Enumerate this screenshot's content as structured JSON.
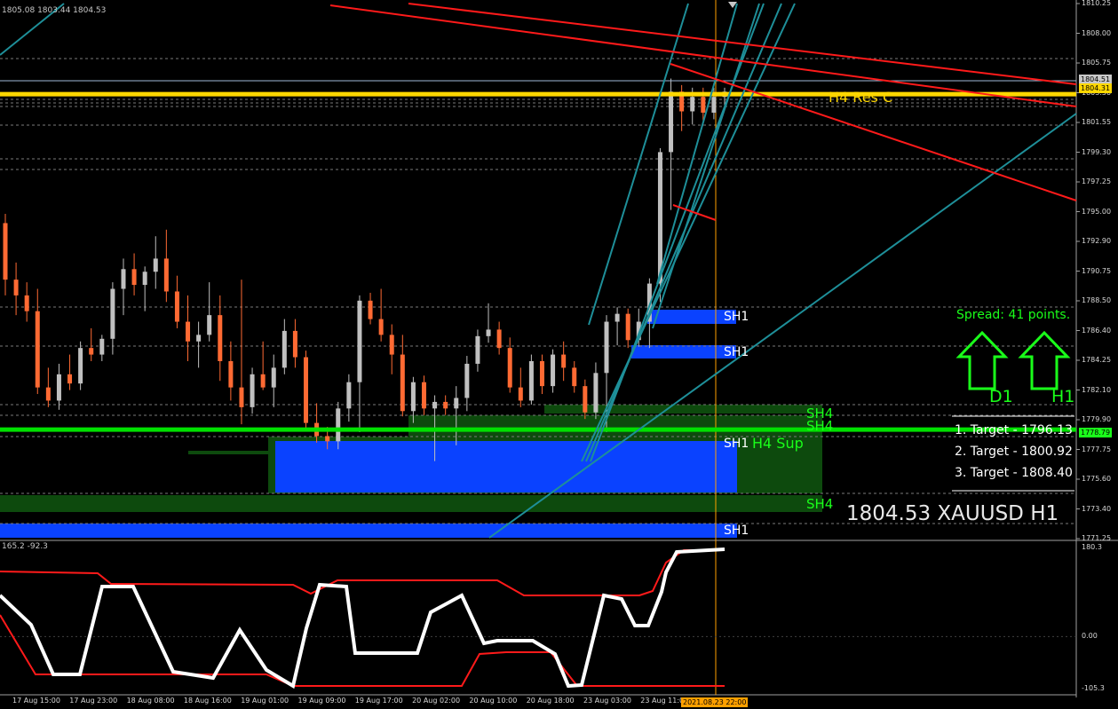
{
  "window": {
    "ohlc_header": "1805.08 1803.44 1804.53"
  },
  "chart_data": {
    "type": "candlestick",
    "symbol": "XAUUSD",
    "timeframe": "H1",
    "last_price": "1804.53",
    "title": "1804.53 XAUUSD H1",
    "ylim": [
      1770.5,
      1811.2
    ],
    "price_ticks": [
      "1810.25",
      "1808.00",
      "1805.75",
      "1803.50",
      "1801.55",
      "1799.30",
      "1797.25",
      "1795.00",
      "1792.90",
      "1790.75",
      "1788.50",
      "1786.40",
      "1784.25",
      "1782.10",
      "1779.90",
      "1777.75",
      "1775.60",
      "1773.40",
      "1771.25"
    ],
    "time_ticks": [
      "17 Aug 15:00",
      "17 Aug 23:00",
      "18 Aug 08:00",
      "18 Aug 16:00",
      "19 Aug 01:00",
      "19 Aug 09:00",
      "19 Aug 17:00",
      "20 Aug 02:00",
      "20 Aug 10:00",
      "20 Aug 18:00",
      "23 Aug 03:00",
      "23 Aug 11:00"
    ],
    "current_time_tag": "2021.08.23 22:00",
    "price_tags": {
      "bid": "1804.31",
      "ask": "1804.51",
      "support": "1778.79"
    },
    "levels": {
      "resistance": {
        "label": "H4 Res C",
        "price": 1804.31,
        "color": "#ffd700"
      },
      "support": {
        "label": "H4 Sup",
        "price": 1778.79,
        "color": "#00e000"
      }
    },
    "zone_labels": {
      "sh1": "SH1",
      "sh4": "SH4"
    },
    "candles": [
      [
        1794.5,
        1795.2,
        1789.0,
        1790.2
      ],
      [
        1790.2,
        1791.5,
        1787.5,
        1789.0
      ],
      [
        1789.0,
        1790.0,
        1787.0,
        1787.8
      ],
      [
        1787.8,
        1789.5,
        1781.5,
        1782.0
      ],
      [
        1782.0,
        1783.5,
        1780.5,
        1781.0
      ],
      [
        1781.0,
        1783.8,
        1780.3,
        1783.0
      ],
      [
        1783.0,
        1784.5,
        1781.8,
        1782.3
      ],
      [
        1782.3,
        1785.5,
        1781.8,
        1785.0
      ],
      [
        1785.0,
        1786.5,
        1784.0,
        1784.5
      ],
      [
        1784.5,
        1786.0,
        1784.0,
        1785.7
      ],
      [
        1785.7,
        1790.0,
        1784.5,
        1789.5
      ],
      [
        1789.5,
        1791.8,
        1787.5,
        1791.0
      ],
      [
        1791.0,
        1792.2,
        1789.0,
        1789.8
      ],
      [
        1789.8,
        1791.2,
        1787.8,
        1790.8
      ],
      [
        1790.8,
        1793.5,
        1789.5,
        1791.8
      ],
      [
        1791.8,
        1794.0,
        1788.5,
        1789.3
      ],
      [
        1789.3,
        1790.5,
        1786.5,
        1787.0
      ],
      [
        1787.0,
        1789.0,
        1784.0,
        1785.5
      ],
      [
        1785.5,
        1787.0,
        1783.5,
        1786.0
      ],
      [
        1786.0,
        1790.0,
        1785.5,
        1787.5
      ],
      [
        1787.5,
        1789.0,
        1782.5,
        1784.0
      ],
      [
        1784.0,
        1785.5,
        1781.0,
        1782.0
      ],
      [
        1782.0,
        1790.2,
        1779.2,
        1780.5
      ],
      [
        1780.5,
        1783.5,
        1780.0,
        1783.0
      ],
      [
        1783.0,
        1785.5,
        1781.8,
        1782.0
      ],
      [
        1782.0,
        1784.5,
        1780.5,
        1783.5
      ],
      [
        1783.5,
        1787.2,
        1783.0,
        1786.3
      ],
      [
        1786.3,
        1787.2,
        1783.5,
        1784.3
      ],
      [
        1784.3,
        1784.8,
        1778.8,
        1779.3
      ],
      [
        1779.3,
        1780.8,
        1777.8,
        1778.3
      ],
      [
        1778.3,
        1779.0,
        1777.3,
        1777.9
      ],
      [
        1777.9,
        1780.9,
        1777.3,
        1780.4
      ],
      [
        1780.4,
        1783.0,
        1779.4,
        1782.4
      ],
      [
        1782.4,
        1789.0,
        1778.6,
        1788.6
      ],
      [
        1788.6,
        1789.2,
        1786.8,
        1787.2
      ],
      [
        1787.2,
        1789.5,
        1785.5,
        1786.0
      ],
      [
        1786.0,
        1786.8,
        1783.0,
        1784.5
      ],
      [
        1784.5,
        1786.0,
        1779.8,
        1780.2
      ],
      [
        1780.2,
        1782.8,
        1779.3,
        1782.4
      ],
      [
        1782.4,
        1782.9,
        1779.9,
        1780.4
      ],
      [
        1780.4,
        1781.4,
        1776.4,
        1780.9
      ],
      [
        1780.9,
        1781.4,
        1779.9,
        1780.4
      ],
      [
        1780.4,
        1782.1,
        1777.6,
        1781.2
      ],
      [
        1781.2,
        1784.4,
        1780.2,
        1783.8
      ],
      [
        1783.8,
        1786.4,
        1783.2,
        1785.9
      ],
      [
        1785.9,
        1788.4,
        1785.4,
        1786.4
      ],
      [
        1786.4,
        1787.0,
        1784.5,
        1785.0
      ],
      [
        1785.0,
        1785.8,
        1781.6,
        1782.0
      ],
      [
        1782.0,
        1783.5,
        1780.5,
        1781.0
      ],
      [
        1781.0,
        1784.5,
        1780.7,
        1784.0
      ],
      [
        1784.0,
        1784.5,
        1781.5,
        1782.1
      ],
      [
        1782.1,
        1784.9,
        1781.6,
        1784.5
      ],
      [
        1784.5,
        1785.5,
        1782.5,
        1783.5
      ],
      [
        1783.5,
        1784.0,
        1781.6,
        1782.1
      ],
      [
        1782.1,
        1782.6,
        1779.6,
        1780.1
      ],
      [
        1780.1,
        1783.9,
        1779.6,
        1783.1
      ],
      [
        1783.1,
        1787.5,
        1778.6,
        1787.0
      ],
      [
        1787.0,
        1788.1,
        1785.2,
        1787.6
      ],
      [
        1787.6,
        1788.0,
        1785.0,
        1785.6
      ],
      [
        1785.6,
        1788.0,
        1785.1,
        1787.0
      ],
      [
        1787.0,
        1790.3,
        1785.0,
        1789.9
      ],
      [
        1789.9,
        1800.2,
        1788.5,
        1799.9
      ],
      [
        1799.9,
        1805.5,
        1795.5,
        1804.5
      ],
      [
        1804.5,
        1805.0,
        1801.5,
        1803.0
      ],
      [
        1803.0,
        1804.8,
        1802.0,
        1804.1
      ],
      [
        1804.1,
        1804.8,
        1802.3,
        1802.9
      ],
      [
        1802.9,
        1804.8,
        1802.4,
        1804.1
      ],
      [
        1804.1,
        1804.8,
        1803.1,
        1804.5
      ]
    ],
    "indicator": {
      "values_header": "165.2 -92.3",
      "ticks": [
        "180.3",
        "0.00",
        "-105.3"
      ],
      "ylim": [
        -105.3,
        180.3
      ]
    },
    "panel_text": {
      "spread": "Spread: 41 points.",
      "arrow_d1": "D1",
      "arrow_h1": "H1",
      "targets": [
        "1. Target - 1796.13",
        "2. Target - 1800.92",
        "3. Target - 1808.40"
      ]
    }
  },
  "colors": {
    "bull": "#c0c0c0",
    "bear": "#ff6a33",
    "teal": "#1e8f99",
    "red": "#ff1a1a",
    "green": "#1aff1a",
    "zone_blue": "#0a42ff",
    "zone_green": "#0d4a0d"
  }
}
